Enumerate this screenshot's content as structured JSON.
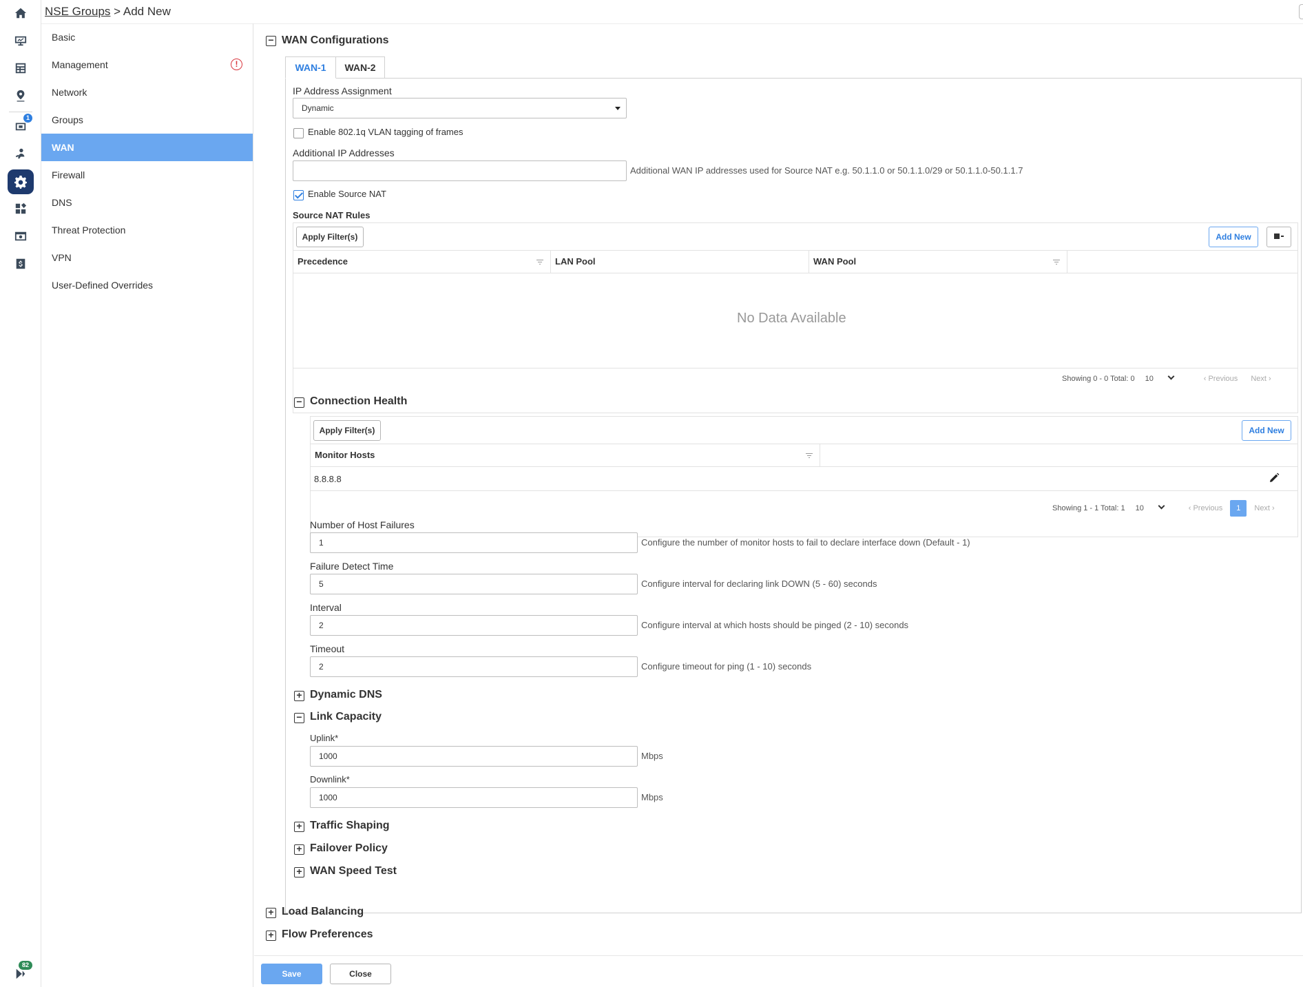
{
  "breadcrumb": {
    "parent": "NSE Groups",
    "separator": " > ",
    "current": "Add New"
  },
  "rail": {
    "notification_badge": "1",
    "chat_badge": "82"
  },
  "secnav": {
    "items": [
      {
        "label": "Basic"
      },
      {
        "label": "Management",
        "warning": "!"
      },
      {
        "label": "Network"
      },
      {
        "label": "Groups"
      },
      {
        "label": "WAN"
      },
      {
        "label": "Firewall"
      },
      {
        "label": "DNS"
      },
      {
        "label": "Threat Protection"
      },
      {
        "label": "VPN"
      },
      {
        "label": "User-Defined Overrides"
      }
    ]
  },
  "wan_config": {
    "title": "WAN Configurations",
    "collapse_symbol": "−",
    "expand_symbol": "+",
    "tabs": [
      "WAN-1",
      "WAN-2"
    ],
    "ip_assignment_label": "IP Address Assignment",
    "ip_assignment_value": "Dynamic",
    "vlan_label": "Enable 802.1q VLAN tagging of frames",
    "additional_ip_label": "Additional IP Addresses",
    "additional_ip_help": "Additional WAN IP addresses used for Source NAT e.g. 50.1.1.0 or 50.1.1.0/29 or 50.1.1.0-50.1.1.7",
    "source_nat_label": "Enable Source NAT",
    "source_nat_rules_title": "Source NAT Rules",
    "apply_filters": "Apply Filter(s)",
    "add_new": "Add New",
    "nat_columns": [
      "Precedence",
      "LAN Pool",
      "WAN Pool"
    ],
    "no_data": "No Data Available",
    "nat_pager": {
      "showing": "Showing 0 - 0 Total: 0",
      "page_size": "10",
      "previous": "Previous",
      "next": "Next"
    }
  },
  "connection_health": {
    "title": "Connection Health",
    "apply_filters": "Apply Filter(s)",
    "add_new": "Add New",
    "column": "Monitor Hosts",
    "rows": [
      "8.8.8.8"
    ],
    "pager": {
      "showing": "Showing 1 - 1 Total: 1",
      "page_size": "10",
      "previous": "Previous",
      "page": "1",
      "next": "Next"
    },
    "fields": [
      {
        "label": "Number of Host Failures",
        "value": "1",
        "help": "Configure the number of monitor hosts to fail to declare interface down (Default - 1)"
      },
      {
        "label": "Failure Detect Time",
        "value": "5",
        "help": "Configure interval for declaring link DOWN (5 - 60) seconds"
      },
      {
        "label": "Interval",
        "value": "2",
        "help": "Configure interval at which hosts should be pinged (2 - 10) seconds"
      },
      {
        "label": "Timeout",
        "value": "2",
        "help": "Configure timeout for ping (1 - 10) seconds"
      }
    ]
  },
  "dynamic_dns": {
    "title": "Dynamic DNS"
  },
  "link_capacity": {
    "title": "Link Capacity",
    "uplink_label": "Uplink*",
    "uplink_value": "1000",
    "downlink_label": "Downlink*",
    "downlink_value": "1000",
    "unit": "Mbps"
  },
  "collapsed_sections": [
    "Traffic Shaping",
    "Failover Policy",
    "WAN Speed Test"
  ],
  "outer_sections": [
    "Load Balancing",
    "Flow Preferences"
  ],
  "footer": {
    "save": "Save",
    "close": "Close"
  }
}
